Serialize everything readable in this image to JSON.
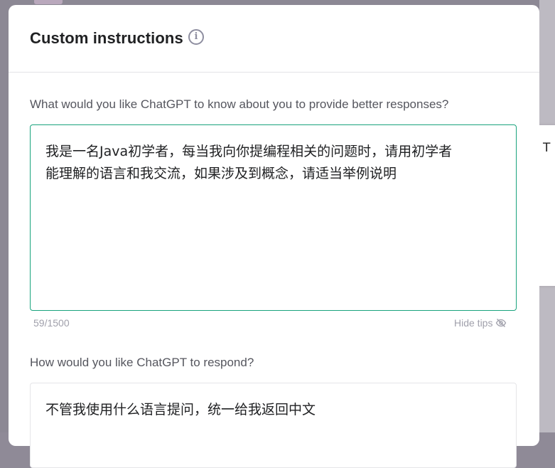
{
  "modal": {
    "title": "Custom instructions",
    "info_icon": "info-icon"
  },
  "about_you": {
    "label": "What would you like ChatGPT to know about you to provide better responses?",
    "value": "我是一名Java初学者，每当我向你提编程相关的问题时，请用初学者\n能理解的语言和我交流，如果涉及到概念，请适当举例说明",
    "char_count": "59/1500",
    "focused": true
  },
  "tips": {
    "label": "Hide tips",
    "icon": "eye-off-icon"
  },
  "respond": {
    "label": "How would you like ChatGPT to respond?",
    "value": "不管我使用什么语言提问，统一给我返回中文"
  },
  "side_card": {
    "text": "T"
  },
  "colors": {
    "accent": "#19a37d",
    "backdrop": "#8c8894",
    "title": "#202123",
    "muted": "#a0a0ab"
  }
}
